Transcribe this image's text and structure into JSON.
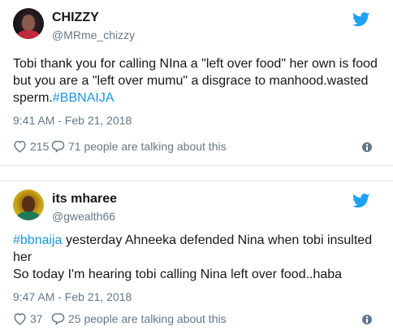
{
  "tweets": [
    {
      "name": "CHIZZY",
      "handle": "@MRme_chizzy",
      "text_before": "Tobi thank you for calling NIna a \"left over food\" her own is food but you are a \"left over mumu\" a disgrace to manhood.wasted sperm.",
      "hashtag": "#BBNAIJA",
      "text_after": "",
      "timestamp": "9:41 AM - Feb 21, 2018",
      "likes": "215",
      "talking": "71 people are talking about this",
      "avatar_icon": "user-avatar",
      "bird_icon": "twitter-bird-icon"
    },
    {
      "name": "its mharee",
      "handle": "@gwealth66",
      "hashtag": "#bbnaija",
      "text_line1": " yesterday Ahneeka defended Nina when tobi insulted her",
      "text_line2": "So today I'm hearing tobi calling Nina left over food..haba",
      "timestamp": "9:47 AM - Feb 21, 2018",
      "likes": "37",
      "talking": "25 people are talking about this",
      "avatar_icon": "user-avatar",
      "bird_icon": "twitter-bird-icon"
    }
  ],
  "colors": {
    "accent": "#1da1f2",
    "hashtag": "#1b95e0",
    "secondary_text": "#657786",
    "border": "#e1e8ed"
  }
}
